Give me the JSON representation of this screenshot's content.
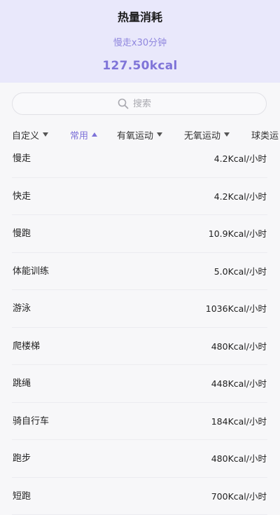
{
  "header": {
    "title": "热量消耗",
    "subtitle": "慢走x30分钟",
    "total": "127.50kcal"
  },
  "search": {
    "placeholder": "搜索",
    "value": ""
  },
  "tabs": [
    {
      "label": "自定义",
      "caret": "down",
      "active": false
    },
    {
      "label": "常用",
      "caret": "up",
      "active": true
    },
    {
      "label": "有氧运动",
      "caret": "down",
      "active": false
    },
    {
      "label": "无氧运动",
      "caret": "down",
      "active": false
    },
    {
      "label": "球类运",
      "caret": "none",
      "active": false
    }
  ],
  "items": [
    {
      "name": "慢走",
      "value": "4.2Kcal/小时"
    },
    {
      "name": "快走",
      "value": "4.2Kcal/小时"
    },
    {
      "name": "慢跑",
      "value": "10.9Kcal/小时"
    },
    {
      "name": "体能训练",
      "value": "5.0Kcal/小时"
    },
    {
      "name": "游泳",
      "value": "1036Kcal/小时"
    },
    {
      "name": "爬楼梯",
      "value": "480Kcal/小时"
    },
    {
      "name": "跳绳",
      "value": "448Kcal/小时"
    },
    {
      "name": "骑自行车",
      "value": "184Kcal/小时"
    },
    {
      "name": "跑步",
      "value": "480Kcal/小时"
    },
    {
      "name": "短跑",
      "value": "700Kcal/小时"
    }
  ],
  "colors": {
    "header_bg": "#e9e8fb",
    "accent": "#7d72d8",
    "subtitle": "#8f86de",
    "page_bg": "#f7f7f9",
    "divider": "#ececf0"
  },
  "icons": {
    "search": "search-icon",
    "caret_down": "caret-down-icon",
    "caret_up": "caret-up-icon"
  }
}
